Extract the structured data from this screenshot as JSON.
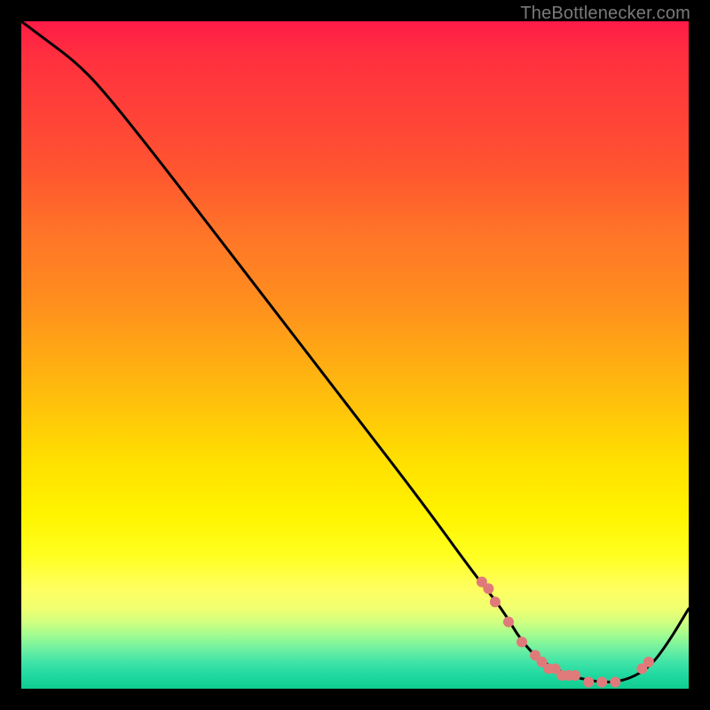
{
  "watermark": "TheBottlenecker.com",
  "chart_data": {
    "type": "line",
    "title": "",
    "xlabel": "",
    "ylabel": "",
    "xlim": [
      0,
      100
    ],
    "ylim": [
      0,
      100
    ],
    "grid": false,
    "legend": false,
    "background_gradient": {
      "direction": "vertical",
      "stops": [
        {
          "pos": 0,
          "color": "#ff1b47"
        },
        {
          "pos": 22,
          "color": "#ff5430"
        },
        {
          "pos": 50,
          "color": "#ffa914"
        },
        {
          "pos": 74,
          "color": "#fff400"
        },
        {
          "pos": 88,
          "color": "#d0ff80"
        },
        {
          "pos": 100,
          "color": "#10cc90"
        }
      ]
    },
    "series": [
      {
        "name": "bottleneck-curve",
        "color": "#000000",
        "x": [
          0,
          4,
          8,
          12,
          20,
          30,
          40,
          50,
          60,
          68,
          72,
          75,
          78,
          82,
          86,
          90,
          94,
          97,
          100
        ],
        "y": [
          100,
          97,
          94,
          90,
          80,
          67,
          54,
          41,
          28,
          17,
          12,
          7,
          4,
          2,
          1,
          1,
          3,
          7,
          12
        ]
      }
    ],
    "markers": {
      "name": "highlighted-range",
      "color": "#e07a7a",
      "radius": 6,
      "x": [
        69,
        70,
        71,
        73,
        75,
        77,
        78,
        79,
        80,
        81,
        82,
        83,
        85,
        87,
        89,
        93,
        94
      ],
      "y": [
        16,
        15,
        13,
        10,
        7,
        5,
        4,
        3,
        3,
        2,
        2,
        2,
        1,
        1,
        1,
        3,
        4
      ]
    }
  }
}
